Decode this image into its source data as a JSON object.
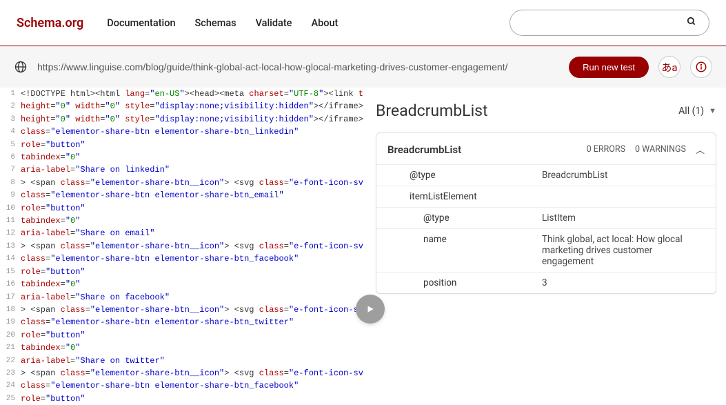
{
  "header": {
    "logo": "Schema.org",
    "nav": [
      "Documentation",
      "Schemas",
      "Validate",
      "About"
    ]
  },
  "toolbar": {
    "url": "https://www.linguise.com/blog/guide/think-global-act-local-how-glocal-marketing-drives-customer-engagement/",
    "run_label": "Run new test",
    "lang_icon": "あa"
  },
  "code_lines": [
    {
      "n": 1,
      "html": "&lt;!DOCTYPE html&gt;&lt;html <span class='c-red'>lang</span>=<span class='c-blue'>\"</span><span class='c-green'>en-US</span><span class='c-blue'>\"</span>&gt;&lt;head&gt;&lt;meta <span class='c-red'>charset</span>=<span class='c-blue'>\"</span><span class='c-green'>UTF-8</span><span class='c-blue'>\"</span>&gt;&lt;link <span class='c-red'>type</span>=<span class='c-blue'>\"</span><span class='c-green'>text/css</span>"
    },
    {
      "n": 2,
      "html": "<span class='c-red'>height</span>=<span class='c-blue'>\"</span><span class='c-green'>0</span><span class='c-blue'>\"</span> <span class='c-red'>width</span>=<span class='c-blue'>\"</span><span class='c-green'>0</span><span class='c-blue'>\"</span> <span class='c-red'>style</span>=<span class='c-blue'>\"display:none;visibility:hidden\"</span>&gt;&lt;/iframe&gt;&lt;/noscript&gt;&lt;i"
    },
    {
      "n": 3,
      "html": "<span class='c-red'>height</span>=<span class='c-blue'>\"</span><span class='c-green'>0</span><span class='c-blue'>\"</span> <span class='c-red'>width</span>=<span class='c-blue'>\"</span><span class='c-green'>0</span><span class='c-blue'>\"</span> <span class='c-red'>style</span>=<span class='c-blue'>\"display:none;visibility:hidden\"</span>&gt;&lt;/iframe&gt;&lt;/noscript&gt;"
    },
    {
      "n": 4,
      "html": "<span class='c-red'>class</span>=<span class='c-blue'>\"elementor-share-btn elementor-share-btn_linkedin\"</span>"
    },
    {
      "n": 5,
      "html": "<span class='c-red'>role</span>=<span class='c-blue'>\"button\"</span>"
    },
    {
      "n": 6,
      "html": "<span class='c-red'>tabindex</span>=<span class='c-blue'>\"</span><span class='c-green'>0</span><span class='c-blue'>\"</span>"
    },
    {
      "n": 7,
      "html": "<span class='c-red'>aria-label</span>=<span class='c-blue'>\"Share on linkedin\"</span>"
    },
    {
      "n": 8,
      "html": "&gt; &lt;span <span class='c-red'>class</span>=<span class='c-blue'>\"elementor-share-btn__icon\"</span>&gt; &lt;svg <span class='c-red'>class</span>=<span class='c-blue'>\"e-font-icon-svg e-fab-linke</span>"
    },
    {
      "n": 9,
      "html": "<span class='c-red'>class</span>=<span class='c-blue'>\"elementor-share-btn elementor-share-btn_email\"</span>"
    },
    {
      "n": 10,
      "html": "<span class='c-red'>role</span>=<span class='c-blue'>\"button\"</span>"
    },
    {
      "n": 11,
      "html": "<span class='c-red'>tabindex</span>=<span class='c-blue'>\"</span><span class='c-green'>0</span><span class='c-blue'>\"</span>"
    },
    {
      "n": 12,
      "html": "<span class='c-red'>aria-label</span>=<span class='c-blue'>\"Share on email\"</span>"
    },
    {
      "n": 13,
      "html": "&gt; &lt;span <span class='c-red'>class</span>=<span class='c-blue'>\"elementor-share-btn__icon\"</span>&gt; &lt;svg <span class='c-red'>class</span>=<span class='c-blue'>\"e-font-icon-svg e-fas-envel</span>"
    },
    {
      "n": 14,
      "html": "<span class='c-red'>class</span>=<span class='c-blue'>\"elementor-share-btn elementor-share-btn_facebook\"</span>"
    },
    {
      "n": 15,
      "html": "<span class='c-red'>role</span>=<span class='c-blue'>\"button\"</span>"
    },
    {
      "n": 16,
      "html": "<span class='c-red'>tabindex</span>=<span class='c-blue'>\"</span><span class='c-green'>0</span><span class='c-blue'>\"</span>"
    },
    {
      "n": 17,
      "html": "<span class='c-red'>aria-label</span>=<span class='c-blue'>\"Share on facebook\"</span>"
    },
    {
      "n": 18,
      "html": "&gt; &lt;span <span class='c-red'>class</span>=<span class='c-blue'>\"elementor-share-btn__icon\"</span>&gt; &lt;svg <span class='c-red'>class</span>=<span class='c-blue'>\"e-font-icon-svg e-fab-faceb</span>"
    },
    {
      "n": 19,
      "html": "<span class='c-red'>class</span>=<span class='c-blue'>\"elementor-share-btn elementor-share-btn_twitter\"</span>"
    },
    {
      "n": 20,
      "html": "<span class='c-red'>role</span>=<span class='c-blue'>\"button\"</span>"
    },
    {
      "n": 21,
      "html": "<span class='c-red'>tabindex</span>=<span class='c-blue'>\"</span><span class='c-green'>0</span><span class='c-blue'>\"</span>"
    },
    {
      "n": 22,
      "html": "<span class='c-red'>aria-label</span>=<span class='c-blue'>\"Share on twitter\"</span>"
    },
    {
      "n": 23,
      "html": "&gt; &lt;span <span class='c-red'>class</span>=<span class='c-blue'>\"elementor-share-btn__icon\"</span>&gt; &lt;svg <span class='c-red'>class</span>=<span class='c-blue'>\"e-font-icon-svg e-fab-twitt</span>"
    },
    {
      "n": 24,
      "html": "<span class='c-red'>class</span>=<span class='c-blue'>\"elementor-share-btn elementor-share-btn_facebook\"</span>"
    },
    {
      "n": 25,
      "html": "<span class='c-red'>role</span>=<span class='c-blue'>\"button\"</span>"
    }
  ],
  "results": {
    "title": "BreadcrumbList",
    "filter": "All (1)",
    "card": {
      "title": "BreadcrumbList",
      "errors": "0 ERRORS",
      "warnings": "0 WARNINGS",
      "rows": [
        {
          "key": "@type",
          "val": "BreadcrumbList",
          "lvl": 1
        },
        {
          "key": "itemListElement",
          "val": "",
          "lvl": 1
        },
        {
          "key": "@type",
          "val": "ListItem",
          "lvl": 2
        },
        {
          "key": "name",
          "val": "Think global, act local: How glocal marketing drives customer engagement",
          "lvl": 2
        },
        {
          "key": "position",
          "val": "3",
          "lvl": 2
        }
      ]
    }
  }
}
